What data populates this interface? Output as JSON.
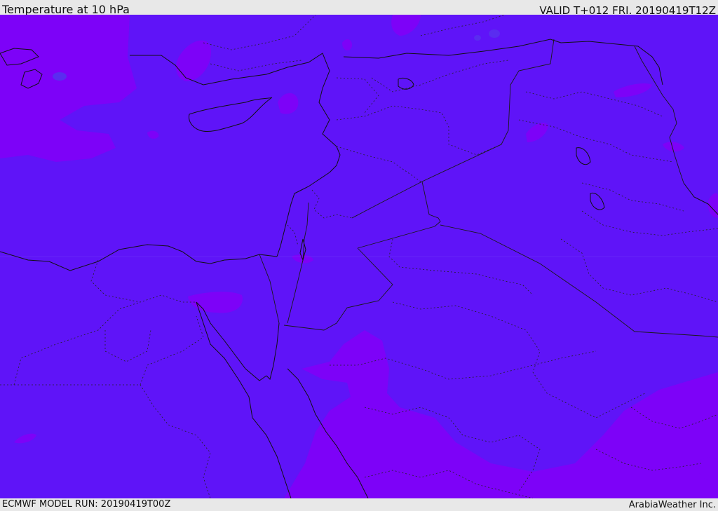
{
  "header": {
    "title": "Temperature at 10 hPa",
    "valid": "VALID T+012 FRI. 20190419T12Z"
  },
  "footer": {
    "model_run": "ECMWF MODEL RUN: 20190419T00Z",
    "provider": "ArabiaWeather Inc."
  },
  "map": {
    "colors": {
      "base": "#5f14f8",
      "warm": "#7d02f8",
      "cool": "#5a2cf0",
      "coast": "#111111",
      "border": "#1a1a1a"
    }
  }
}
